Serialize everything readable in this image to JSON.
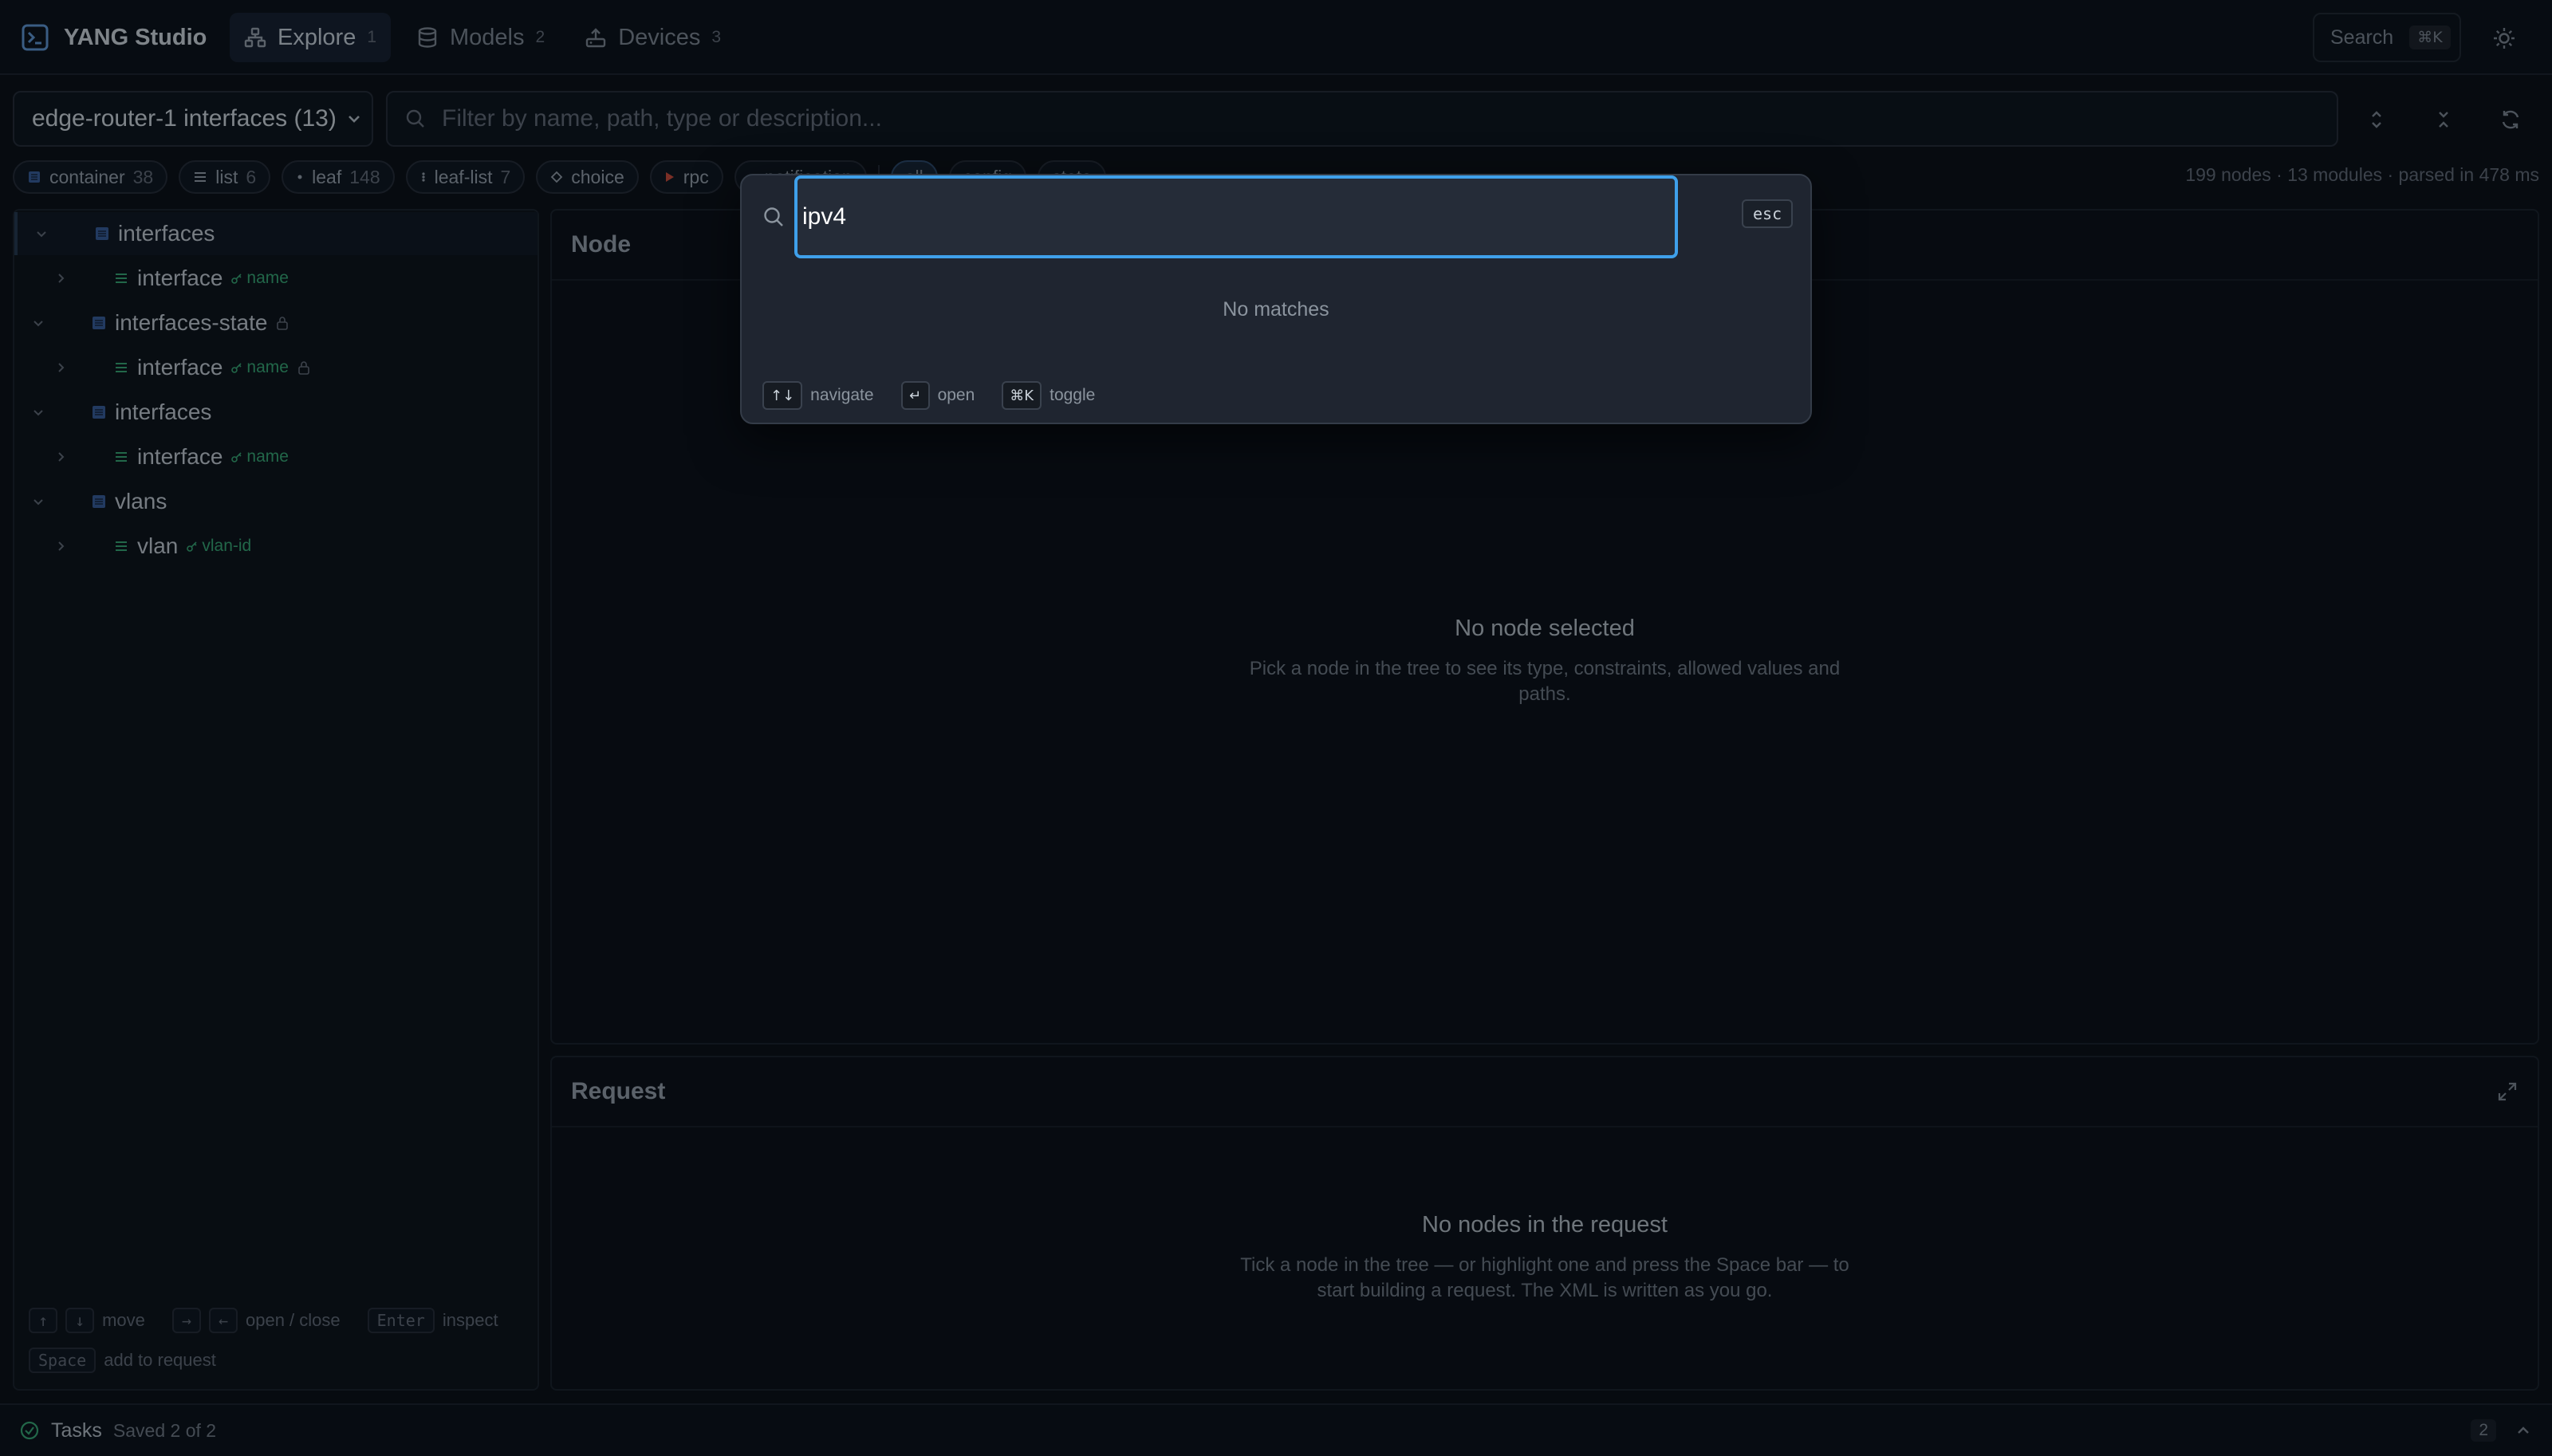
{
  "app": {
    "title": "YANG Studio"
  },
  "nav": {
    "tabs": [
      {
        "label": "Explore",
        "count": "1",
        "active": true
      },
      {
        "label": "Models",
        "count": "2",
        "active": false
      },
      {
        "label": "Devices",
        "count": "3",
        "active": false
      }
    ]
  },
  "header": {
    "search_label": "Search",
    "search_shortcut": "⌘K"
  },
  "toolbar": {
    "dataset_value": "edge-router-1 interfaces (13)",
    "filter_placeholder": "Filter by name, path, type or description..."
  },
  "chips": [
    {
      "label": "container",
      "count": "38"
    },
    {
      "label": "list",
      "count": "6"
    },
    {
      "label": "leaf",
      "count": "148"
    },
    {
      "label": "leaf-list",
      "count": "7"
    },
    {
      "label": "choice",
      "count": ""
    },
    {
      "label": "rpc",
      "count": ""
    },
    {
      "label": "notification",
      "count": ""
    },
    {
      "label": "all",
      "count": ""
    },
    {
      "label": "config",
      "count": ""
    },
    {
      "label": "state",
      "count": ""
    }
  ],
  "stats": "199 nodes · 13 modules · parsed in 478 ms",
  "tree": {
    "rows": [
      {
        "label": "interfaces",
        "key": "",
        "locked": false
      },
      {
        "label": "interface",
        "key": "name",
        "locked": false
      },
      {
        "label": "interfaces-state",
        "key": "",
        "locked": true
      },
      {
        "label": "interface",
        "key": "name",
        "locked": true
      },
      {
        "label": "interfaces",
        "key": "",
        "locked": false
      },
      {
        "label": "interface",
        "key": "name",
        "locked": false
      },
      {
        "label": "vlans",
        "key": "",
        "locked": false
      },
      {
        "label": "vlan",
        "key": "vlan-id",
        "locked": false
      }
    ],
    "hints": {
      "up": "↑",
      "down": "↓",
      "move": "move",
      "right": "→",
      "left": "←",
      "open_close": "open / close",
      "enter": "Enter",
      "inspect": "inspect",
      "space": "Space",
      "add": "add to request"
    }
  },
  "node_panel": {
    "title": "Node",
    "empty_title": "No node selected",
    "empty_text": "Pick a node in the tree to see its type, constraints, allowed values and paths."
  },
  "request_panel": {
    "title": "Request",
    "empty_title": "No nodes in the request",
    "empty_text": "Tick a node in the tree — or highlight one and press the Space bar — to start building a request. The XML is written as you go."
  },
  "statusbar": {
    "label": "Tasks",
    "status": "Saved 2 of 2",
    "count": "2"
  },
  "palette": {
    "query": "ipv4",
    "esc": "esc",
    "empty": "No matches",
    "hints": [
      {
        "key": "↑↓",
        "label": "navigate"
      },
      {
        "key": "↵",
        "label": "open"
      },
      {
        "key": "⌘K",
        "label": "toggle"
      }
    ]
  },
  "colors": {
    "accent": "#3fa0ea",
    "key_green": "#3fb97f",
    "bg": "#0d1117"
  }
}
